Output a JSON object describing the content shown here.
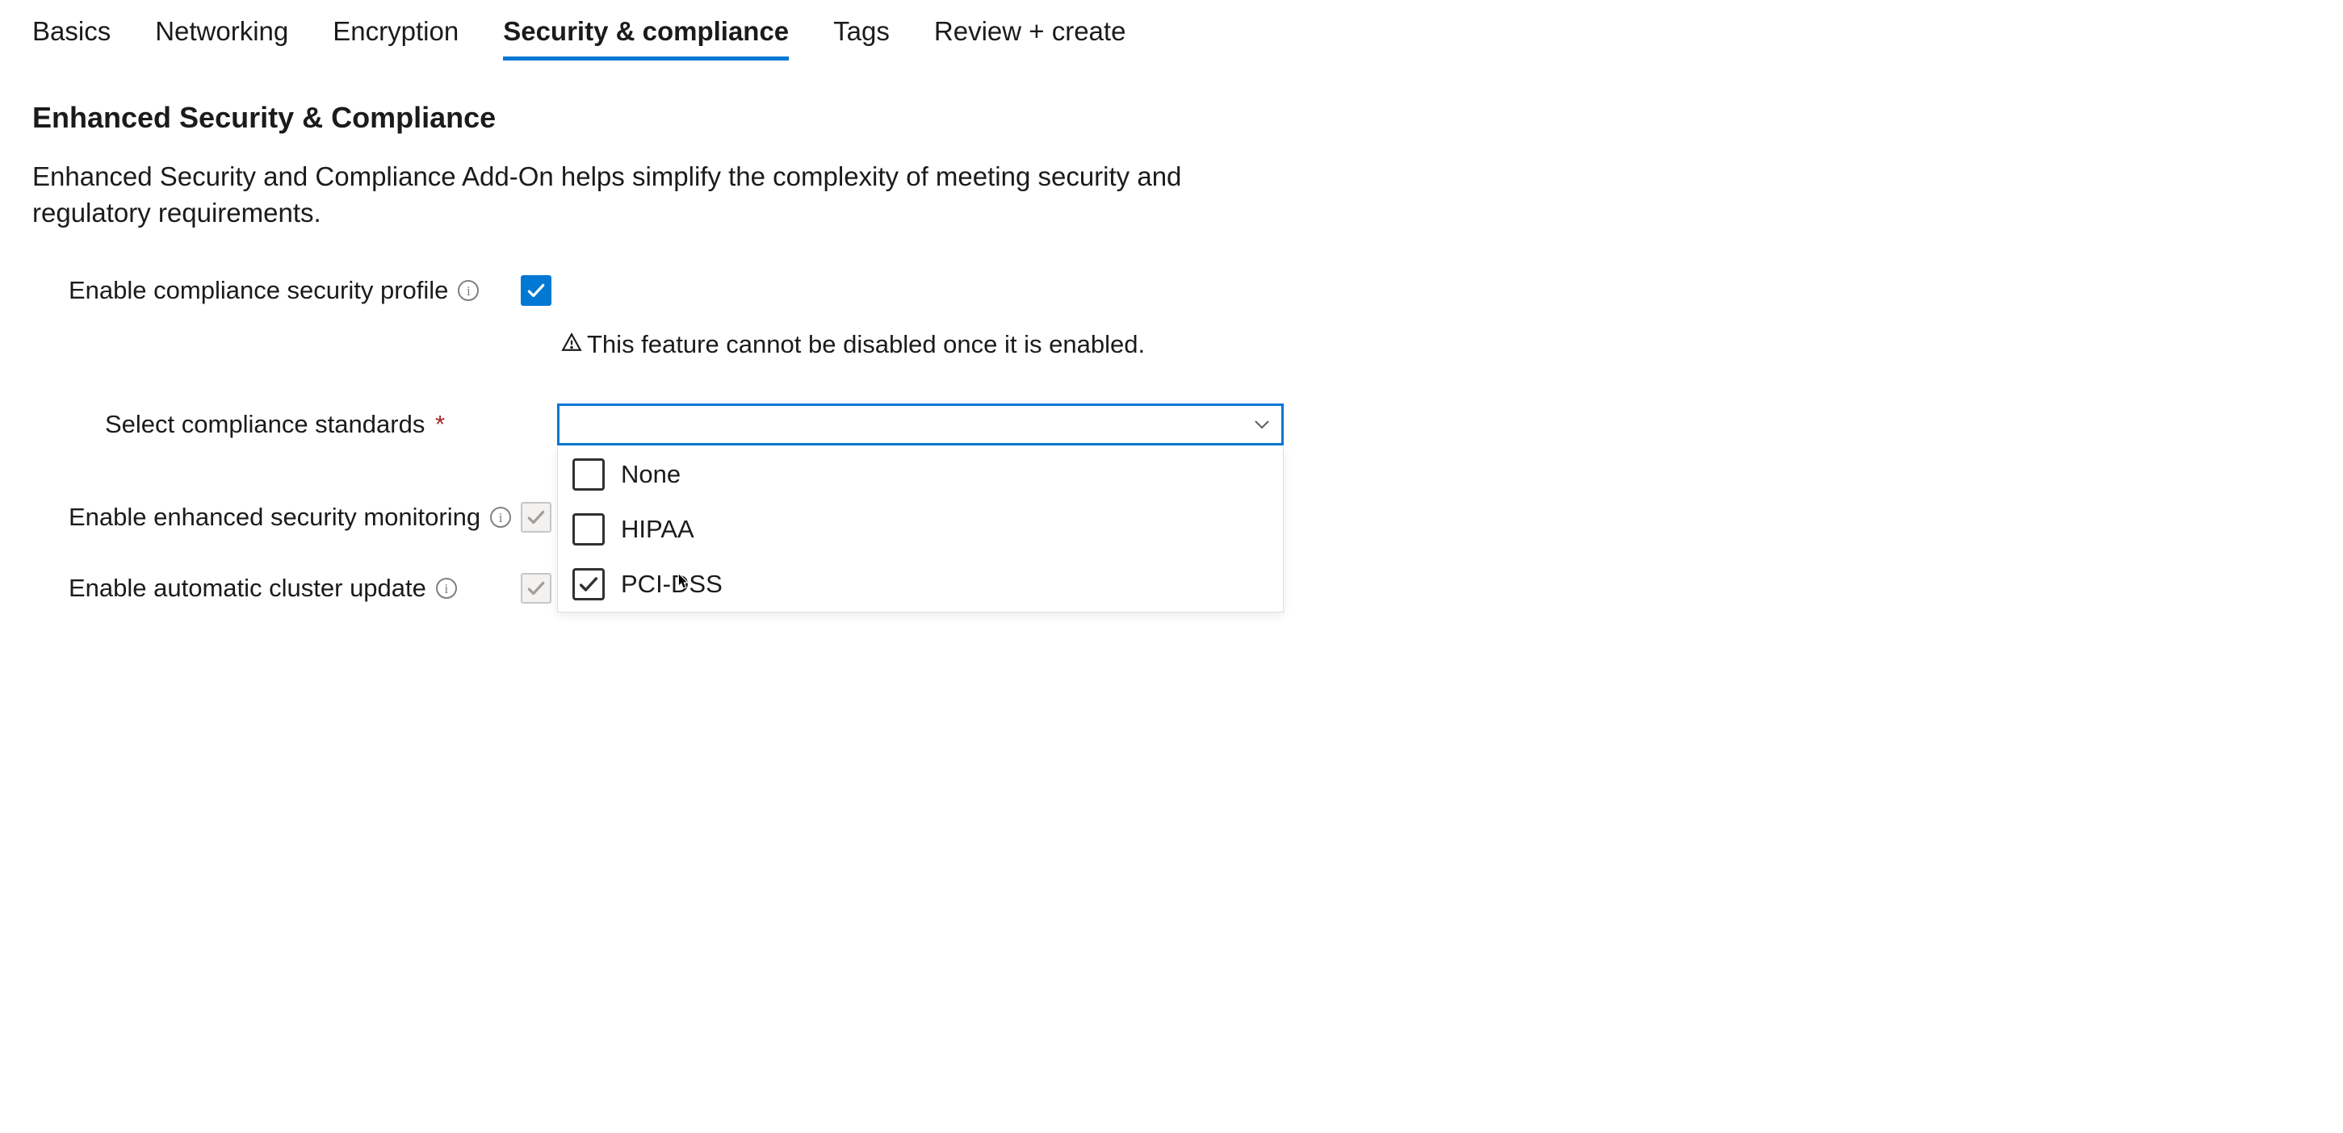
{
  "tabs": [
    {
      "label": "Basics",
      "active": false
    },
    {
      "label": "Networking",
      "active": false
    },
    {
      "label": "Encryption",
      "active": false
    },
    {
      "label": "Security & compliance",
      "active": true
    },
    {
      "label": "Tags",
      "active": false
    },
    {
      "label": "Review + create",
      "active": false
    }
  ],
  "section": {
    "title": "Enhanced Security & Compliance",
    "description": "Enhanced Security and Compliance Add-On helps simplify the complexity of meeting security and regulatory requirements."
  },
  "fields": {
    "enable_profile": {
      "label": "Enable compliance security profile",
      "checked": true,
      "warning": "This feature cannot be disabled once it is enabled."
    },
    "compliance_standards": {
      "label": "Select compliance standards",
      "required_marker": "*",
      "selected_value": "",
      "options": [
        {
          "label": "None",
          "checked": false
        },
        {
          "label": "HIPAA",
          "checked": false
        },
        {
          "label": "PCI-DSS",
          "checked": true
        }
      ]
    },
    "enable_monitoring": {
      "label": "Enable enhanced security monitoring",
      "checked": true,
      "disabled": true
    },
    "enable_auto_update": {
      "label": "Enable automatic cluster update",
      "checked": true,
      "disabled": true
    }
  }
}
